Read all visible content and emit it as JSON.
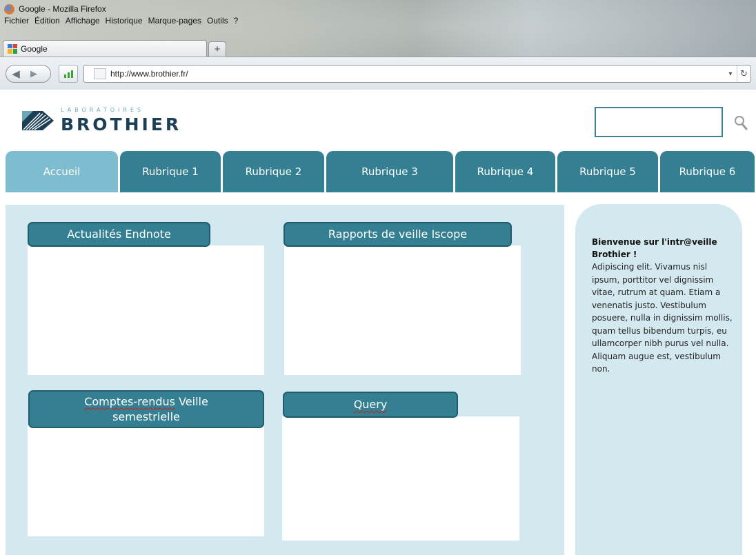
{
  "browser": {
    "window_title": "Google - Mozilla Firefox",
    "menu": [
      "Fichier",
      "Édition",
      "Affichage",
      "Historique",
      "Marque-pages",
      "Outils",
      "?"
    ],
    "tab_label": "Google",
    "new_tab_symbol": "+",
    "url": "http://www.brothier.fr/"
  },
  "site": {
    "logo_top": "LABORATOIRES",
    "logo_name": "BROTHIER",
    "search_placeholder": "",
    "nav": [
      "Accueil",
      "Rubrique 1",
      "Rubrique 2",
      "Rubrique 3",
      "Rubrique 4",
      "Rubrique 5",
      "Rubrique 6"
    ],
    "active_nav": "Accueil",
    "widgets": {
      "w1_title": "Actualités  Endnote",
      "w2_title": "Rapports  de veille  Iscope",
      "w3_title_a": "Comptes-rendus",
      "w3_title_b": "  Veille",
      "w3_title_c": "semestrielle",
      "w4_title": "Query"
    },
    "sidebar": {
      "title": "Bienvenue sur l'intr@veille Brothier !",
      "body": "Adipiscing elit. Vivamus nisl ipsum, porttitor vel dignissim vitae, rutrum at quam. Etiam a venenatis justo. Vestibulum posuere, nulla in dignissim mollis, quam tellus bibendum turpis, eu ullamcorper nibh purus vel nulla. Aliquam augue est, vestibulum non."
    }
  },
  "colors": {
    "nav_tab": "#347f92",
    "nav_tab_active": "#7dbdcf",
    "content_bg": "#d4e9ef",
    "brand_dark": "#1c3f55"
  },
  "icons": [
    "firefox-logo-icon",
    "google-favicon-icon",
    "back-arrow-icon",
    "forward-arrow-icon",
    "signal-bars-icon",
    "page-icon",
    "dropdown-icon",
    "reload-icon",
    "search-icon"
  ]
}
